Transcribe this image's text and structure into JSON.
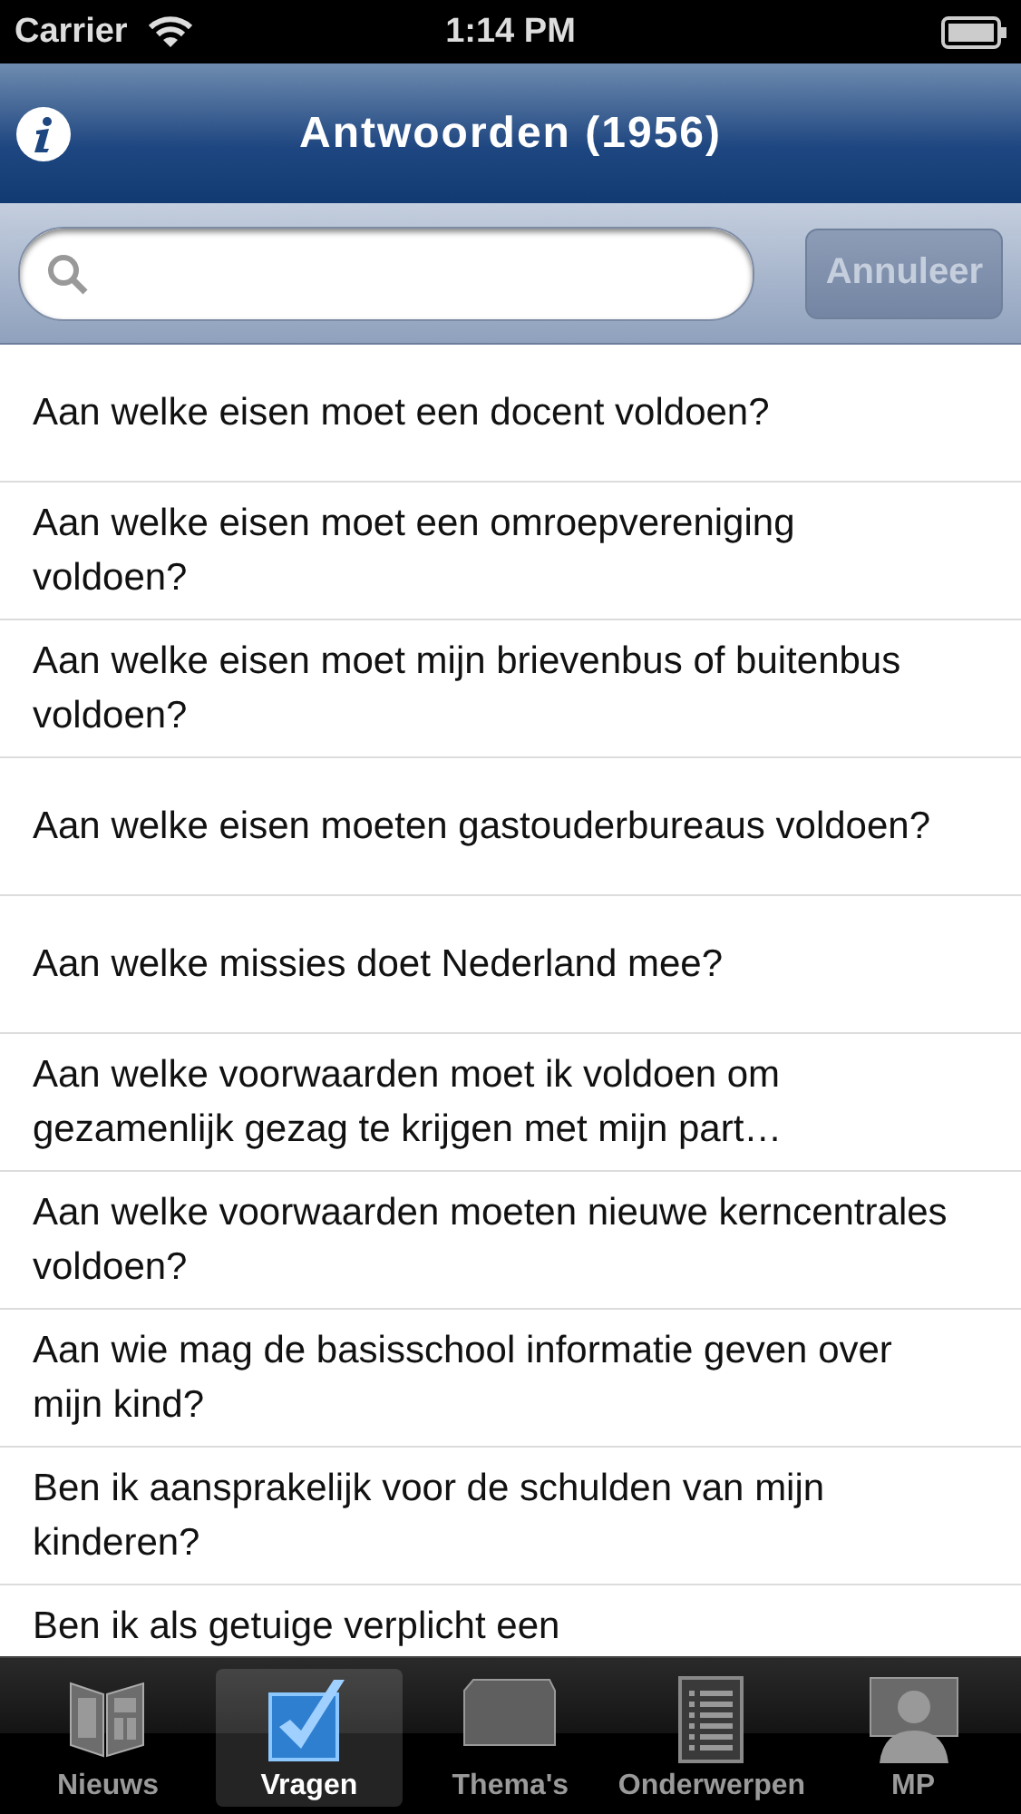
{
  "status_bar": {
    "carrier": "Carrier",
    "time": "1:14 PM"
  },
  "nav_bar": {
    "title": "Antwoorden (1956)"
  },
  "search": {
    "cancel": "Annuleer",
    "cancel_disabled": true
  },
  "questions": [
    "Aan welke eisen moet een docent voldoen?",
    "Aan welke eisen moet een omroepvereniging voldoen?",
    "Aan welke eisen moet mijn brievenbus of buitenbus voldoen?",
    "Aan welke eisen moeten gastouderbureaus voldoen?",
    "Aan welke missies doet Nederland mee?",
    "Aan welke voorwaarden moet ik voldoen om gezamenlijk gezag te krijgen met mijn part…",
    "Aan welke voorwaarden moeten nieuwe kerncentrales voldoen?",
    "Aan wie mag de basisschool informatie geven over mijn kind?",
    "Ben ik aansprakelijk voor de schulden van mijn kinderen?",
    "Ben ik als getuige verplicht een"
  ],
  "tabs": [
    {
      "label": "Nieuws",
      "kind": "news",
      "selected": false
    },
    {
      "label": "Vragen",
      "kind": "check",
      "selected": true
    },
    {
      "label": "Thema's",
      "kind": "folder",
      "selected": false
    },
    {
      "label": "Onderwerpen",
      "kind": "list",
      "selected": false
    },
    {
      "label": "MP",
      "kind": "person",
      "selected": false
    }
  ]
}
